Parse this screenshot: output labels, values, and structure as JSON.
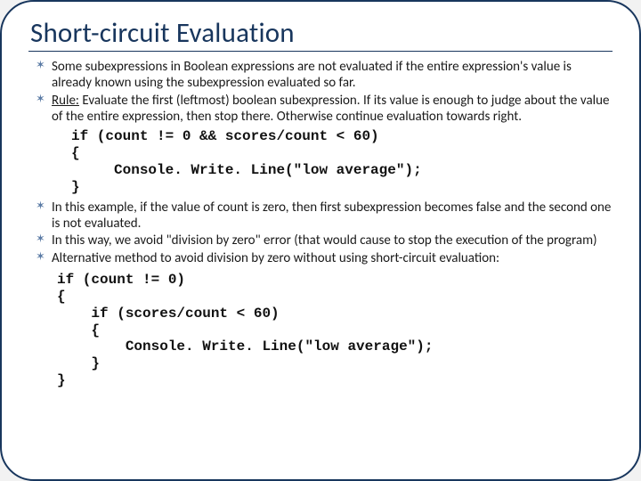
{
  "title": "Short-circuit Evaluation",
  "bullets": {
    "b1": "Some subexpressions in Boolean expressions are not evaluated if the entire expression's value is already known using the subexpression evaluated so far.",
    "b2_prefix": "Rule:",
    "b2_rest": " Evaluate the first (leftmost) boolean subexpression. If its value is enough to judge about the value of the entire expression, then stop there. Otherwise continue evaluation towards right.",
    "b3": "In this example, if the value of count is zero, then first subexpression becomes false and the second one is not evaluated.",
    "b4": "In this way, we avoid \"division by zero\" error (that would cause to stop the execution of the program)",
    "b5": "Alternative method to avoid division by zero without using short-circuit evaluation:"
  },
  "code1": "if (count != 0 && scores/count < 60)\n{\n     Console. Write. Line(\"low average\");\n}",
  "code2": "if (count != 0)\n{\n    if (scores/count < 60)\n    {\n        Console. Write. Line(\"low average\");\n    }\n}"
}
